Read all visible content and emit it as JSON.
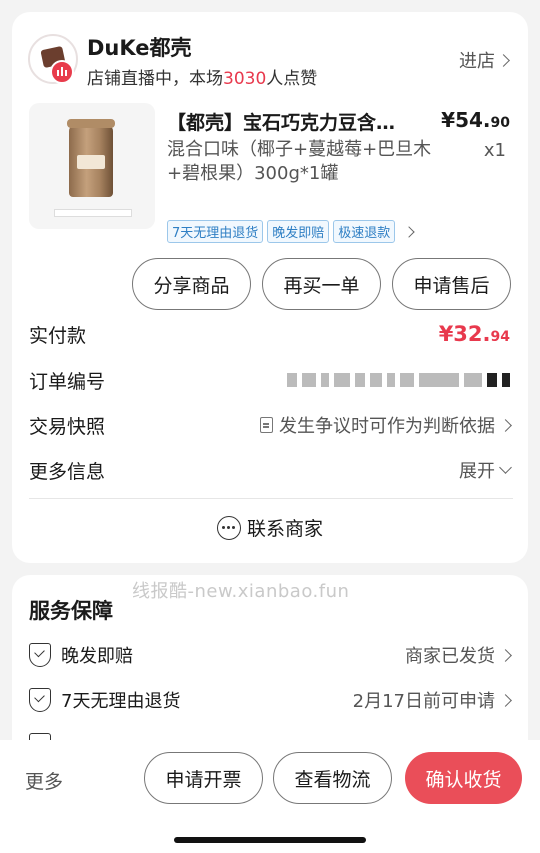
{
  "shop": {
    "name": "DuKe都壳",
    "status_prefix": "店铺直播中，本场",
    "like_count": "3030",
    "status_suffix": "人点赞",
    "enter_label": "进店"
  },
  "product": {
    "title": "【都壳】宝石巧克力豆含…",
    "price_main": "¥54.",
    "price_decimal": "90",
    "spec": "混合口味（椰子+蔓越莓+巴旦木+碧根果）300g*1罐",
    "quantity": "x1",
    "tags": [
      "7天无理由退货",
      "晚发即赔",
      "极速退款"
    ]
  },
  "actions": {
    "share": "分享商品",
    "rebuy": "再买一单",
    "after_sale": "申请售后"
  },
  "info": {
    "paid_label": "实付款",
    "paid_main": "¥32.",
    "paid_decimal": "94",
    "order_no_label": "订单编号",
    "snapshot_label": "交易快照",
    "snapshot_value": "发生争议时可作为判断依据",
    "more_label": "更多信息",
    "more_value": "展开"
  },
  "contact": {
    "label": "联系商家"
  },
  "watermark": "线报酷-new.xianbao.fun",
  "service": {
    "title": "服务保障",
    "items": [
      {
        "label": "晚发即赔",
        "value": "商家已发货"
      },
      {
        "label": "7天无理由退货",
        "value": "2月17日前可申请"
      }
    ]
  },
  "bottom": {
    "more": "更多",
    "invoice": "申请开票",
    "logistics": "查看物流",
    "confirm": "确认收货"
  },
  "colors": {
    "accent": "#e8394d",
    "confirm_bg": "#ea4e59",
    "tag_blue": "#2f7fc4"
  }
}
